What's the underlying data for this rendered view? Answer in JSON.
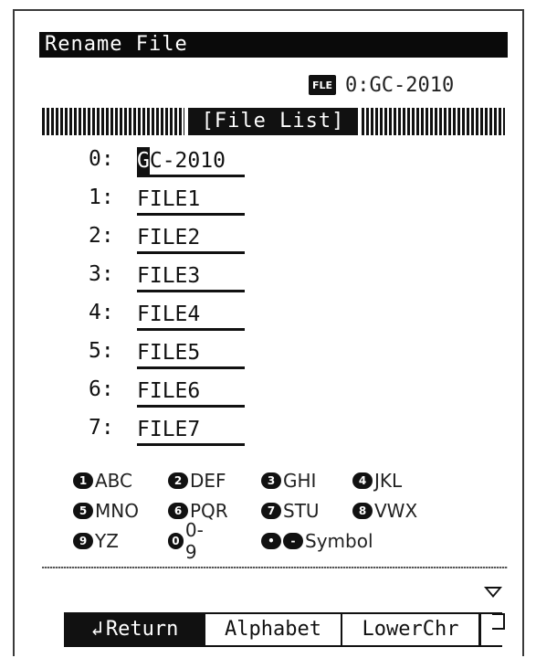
{
  "title": "Rename File",
  "current_file": {
    "icon_text": "FLE",
    "label": "0:GC-2010"
  },
  "section_header": "[File List]",
  "files": [
    {
      "num": "0:",
      "cursor": "G",
      "name_rest": "C-2010"
    },
    {
      "num": "1:",
      "name": "FILE1"
    },
    {
      "num": "2:",
      "name": "FILE2"
    },
    {
      "num": "3:",
      "name": "FILE3"
    },
    {
      "num": "4:",
      "name": "FILE4"
    },
    {
      "num": "5:",
      "name": "FILE5"
    },
    {
      "num": "6:",
      "name": "FILE6"
    },
    {
      "num": "7:",
      "name": "FILE7"
    }
  ],
  "keypad": {
    "row1": [
      {
        "key": "1",
        "label": "ABC"
      },
      {
        "key": "2",
        "label": "DEF"
      },
      {
        "key": "3",
        "label": "GHI"
      },
      {
        "key": "4",
        "label": "JKL"
      }
    ],
    "row2": [
      {
        "key": "5",
        "label": "MNO"
      },
      {
        "key": "6",
        "label": "PQR"
      },
      {
        "key": "7",
        "label": "STU"
      },
      {
        "key": "8",
        "label": "VWX"
      }
    ],
    "row3": [
      {
        "key": "9",
        "label": "YZ"
      },
      {
        "key": "0",
        "label": "0-9"
      },
      {
        "key": "•",
        "key2": "-",
        "label": "Symbol"
      }
    ]
  },
  "softkeys": {
    "return_icon": "↲",
    "return_label": "Return",
    "alphabet_label": "Alphabet",
    "lowerchr_label": "LowerChr"
  }
}
